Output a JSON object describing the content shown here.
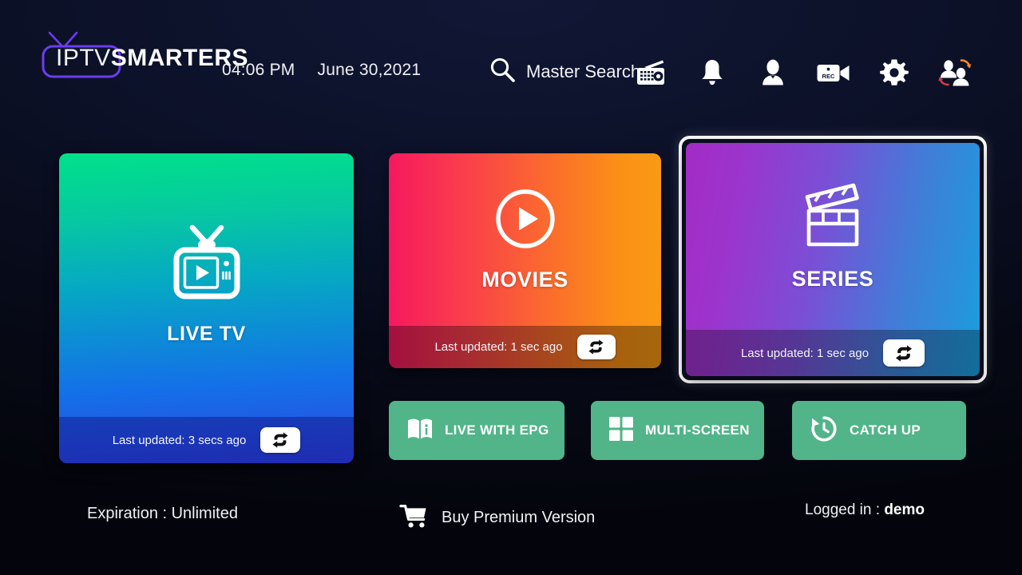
{
  "app": {
    "brand_light": "IPTV",
    "brand_bold": "SMARTERS",
    "brand_icon": "tv-logo-icon"
  },
  "header": {
    "time": "04:06 PM",
    "date": "June 30,2021",
    "search": {
      "icon": "search-icon",
      "label": "Master Search"
    },
    "icons": [
      {
        "name": "radio-icon",
        "label": "Radio"
      },
      {
        "name": "bell-icon",
        "label": "Notifications"
      },
      {
        "name": "person-icon",
        "label": "Account"
      },
      {
        "name": "rec-camera-icon",
        "label": "Recordings"
      },
      {
        "name": "gear-icon",
        "label": "Settings"
      },
      {
        "name": "switch-user-icon",
        "label": "Switch User"
      }
    ]
  },
  "cards": {
    "live_tv": {
      "title": "LIVE TV",
      "icon": "retro-tv-play-icon",
      "updated": "Last updated: 3 secs ago",
      "refresh_icon": "refresh-loop-icon",
      "gradient_from": "#00e18a",
      "gradient_to": "#2d46e0",
      "focused": false
    },
    "movies": {
      "title": "MOVIES",
      "icon": "play-circle-icon",
      "updated": "Last updated: 1 sec ago",
      "refresh_icon": "refresh-loop-icon",
      "gradient_from": "#f6185f",
      "gradient_to": "#f99a14",
      "focused": false
    },
    "series": {
      "title": "SERIES",
      "icon": "clapperboard-icon",
      "updated": "Last updated: 1 sec ago",
      "refresh_icon": "refresh-loop-icon",
      "gradient_from": "#a32bc4",
      "gradient_to": "#1a9ede",
      "focused": true,
      "focus_border_color": "#ffffff"
    }
  },
  "quick_actions": {
    "color": "#52b489",
    "items": [
      {
        "label": "LIVE WITH EPG",
        "icon": "book-info-icon"
      },
      {
        "label": "MULTI-SCREEN",
        "icon": "grid-four-icon"
      },
      {
        "label": "CATCH UP",
        "icon": "clock-rewind-icon"
      }
    ]
  },
  "footer": {
    "expiration": "Expiration : Unlimited",
    "buy": {
      "icon": "shopping-cart-icon",
      "label": "Buy Premium Version"
    },
    "logged_in_label": "Logged in : ",
    "logged_in_user": "demo"
  }
}
